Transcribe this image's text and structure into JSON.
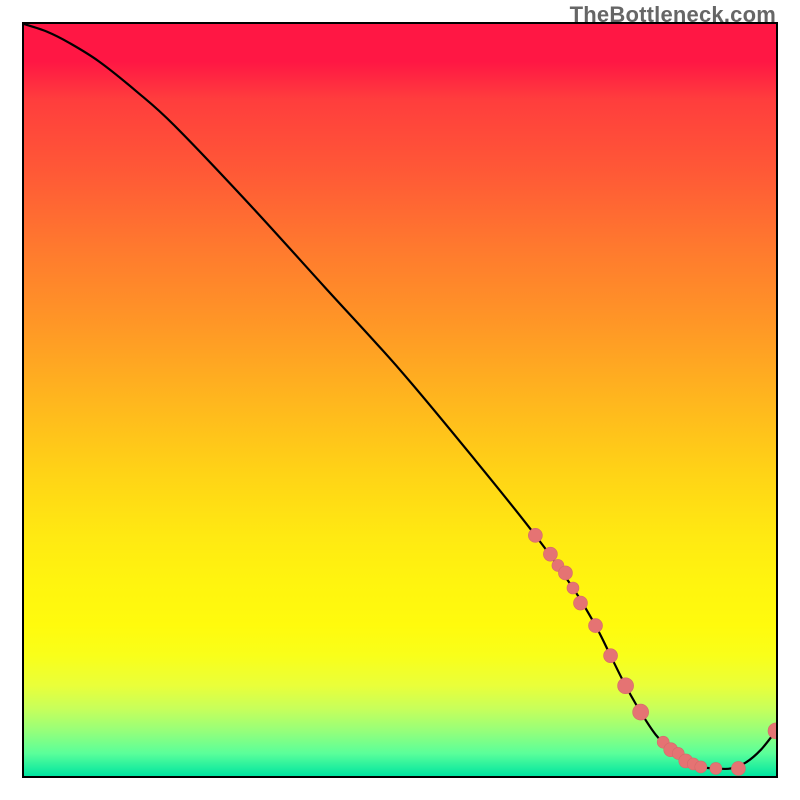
{
  "watermark": "TheBottleneck.com",
  "colors": {
    "line": "#000000",
    "marker_fill": "#e57373",
    "marker_stroke": "#d46a6a",
    "border": "#000000"
  },
  "chart_data": {
    "type": "line",
    "title": "",
    "xlabel": "",
    "ylabel": "",
    "xlim": [
      0,
      100
    ],
    "ylim": [
      0,
      100
    ],
    "grid": false,
    "legend": false,
    "series": [
      {
        "name": "bottleneck-curve",
        "x": [
          0,
          3,
          6,
          10,
          15,
          20,
          30,
          40,
          50,
          60,
          68,
          73,
          76,
          78,
          80,
          82,
          84,
          86,
          88,
          90,
          92,
          94,
          96,
          98,
          100
        ],
        "values": [
          100,
          99,
          97.5,
          95,
          91,
          86.5,
          76,
          65,
          54,
          42,
          32,
          25,
          20,
          16,
          12,
          8.5,
          5.5,
          3.5,
          2,
          1.2,
          1,
          1,
          1.8,
          3.5,
          6
        ]
      }
    ],
    "markers": [
      {
        "name": "highlighted-points",
        "x": [
          68,
          70,
          71,
          72,
          73,
          74,
          76,
          78,
          80,
          82,
          85,
          86,
          87,
          88,
          89,
          90,
          92,
          95,
          100
        ],
        "values": [
          32,
          29.5,
          28,
          27,
          25,
          23,
          20,
          16,
          12,
          8.5,
          4.5,
          3.5,
          3,
          2,
          1.6,
          1.2,
          1,
          1,
          6
        ],
        "radius": [
          7,
          7,
          6,
          7,
          6,
          7,
          7,
          7,
          8,
          8,
          6,
          7,
          6,
          7,
          6,
          6,
          6,
          7,
          8
        ]
      }
    ]
  }
}
